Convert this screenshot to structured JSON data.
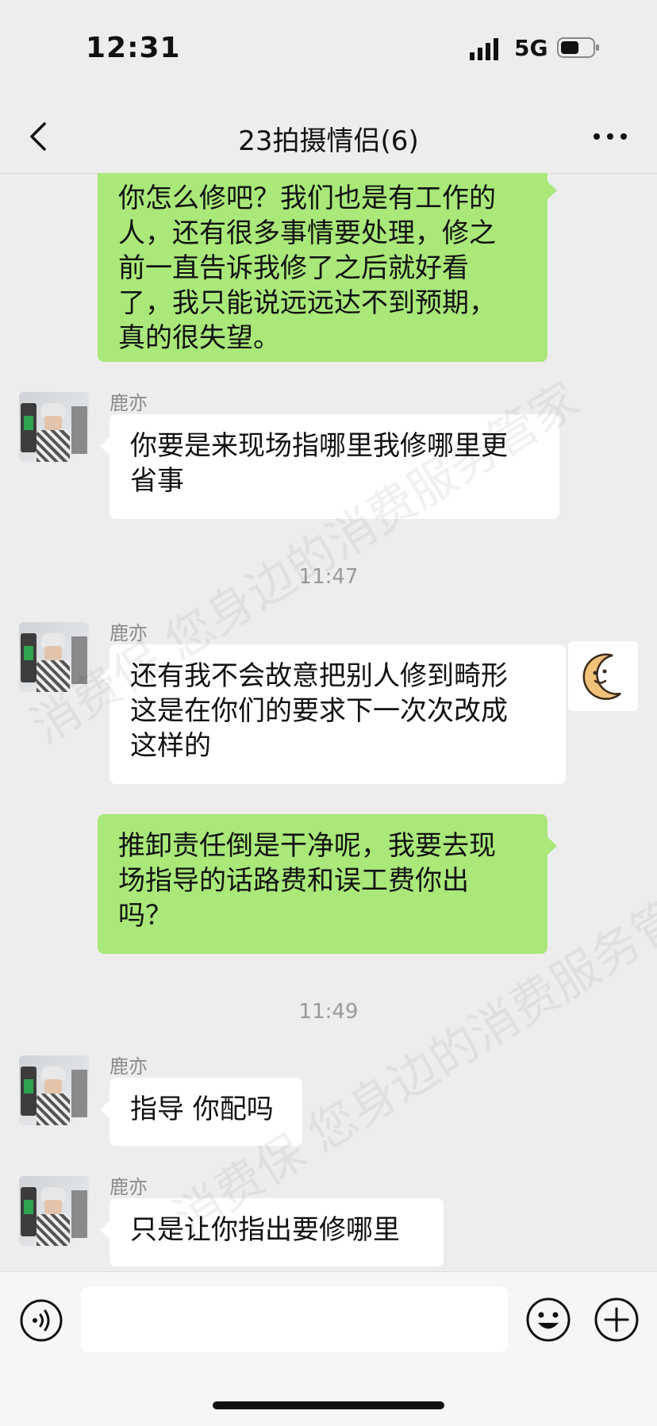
{
  "status_bar": {
    "time": "12:31",
    "network": "5G"
  },
  "header": {
    "title": "23拍摄情侣(6)"
  },
  "messages": [
    {
      "dir": "out",
      "lines": [
        "你怎么修吧？我们也是有工作的",
        "人，还有很多事情要处理，修之",
        "前一直告诉我修了之后就好看",
        "了，我只能说远远达不到预期，",
        "真的很失望。"
      ]
    },
    {
      "dir": "in",
      "sender": "鹿亦",
      "lines": [
        "你要是来现场指哪里我修哪里更",
        "省事"
      ]
    },
    {
      "dir": "in",
      "sender": "鹿亦",
      "lines": [
        "还有我不会故意把别人修到畸形",
        "这是在你们的要求下一次次改成",
        "这样的"
      ]
    },
    {
      "dir": "out",
      "lines": [
        "推卸责任倒是干净呢，我要去现",
        "场指导的话路费和误工费你出",
        "吗？"
      ]
    },
    {
      "dir": "in",
      "sender": "鹿亦",
      "lines": [
        "指导 你配吗"
      ]
    },
    {
      "dir": "in",
      "sender": "鹿亦",
      "lines": [
        "只是让你指出要修哪里"
      ]
    }
  ],
  "timestamps": [
    "11:47",
    "11:49"
  ],
  "input_bar": {
    "placeholder": ""
  },
  "watermark": {
    "text": "消费保 您身边的消费服务管家"
  },
  "icons": [
    "back-arrow-icon",
    "more-icon",
    "voice-icon",
    "emoji-icon",
    "plus-icon",
    "moon-face-icon"
  ],
  "colors": {
    "background": "#ededed",
    "outgoing_bubble": "#a9e879",
    "incoming_bubble": "#ffffff"
  }
}
